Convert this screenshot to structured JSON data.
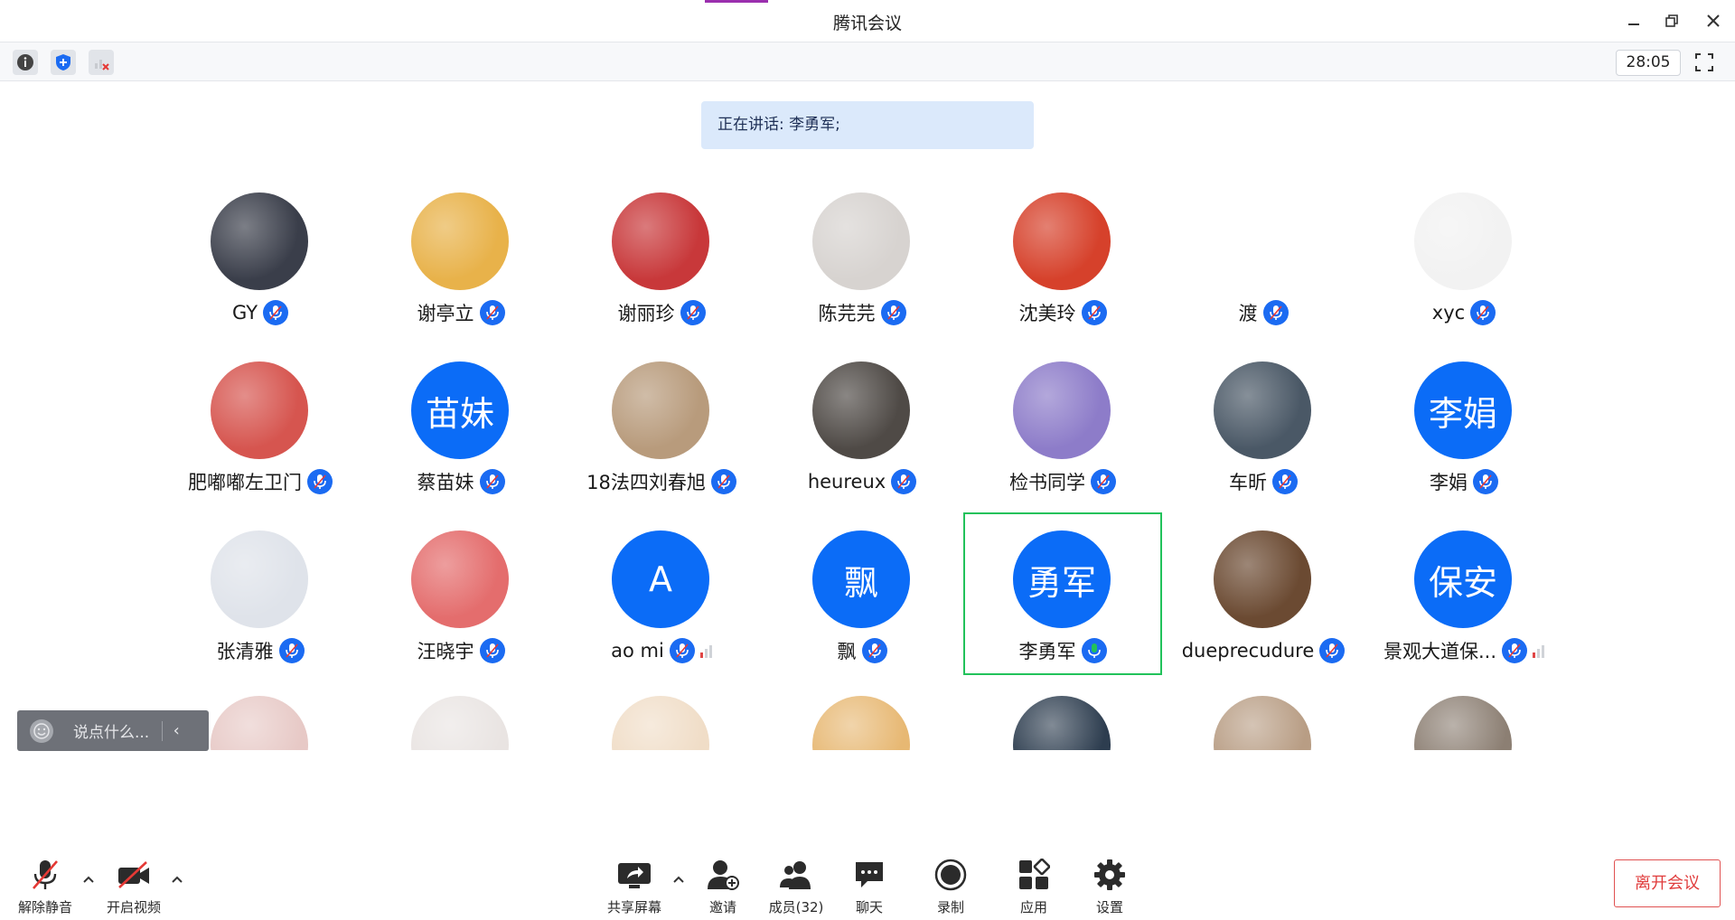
{
  "app": {
    "title": "腾讯会议",
    "timer": "28:05"
  },
  "speaking": {
    "text": "正在讲话: 李勇军;"
  },
  "participants": [
    {
      "name": "GY",
      "avatar": "photo",
      "color": "#3a3e4a"
    },
    {
      "name": "谢亭立",
      "avatar": "photo",
      "color": "#e8b24a"
    },
    {
      "name": "谢丽珍",
      "avatar": "photo",
      "color": "#c8383a"
    },
    {
      "name": "陈芫芫",
      "avatar": "photo",
      "color": "#d7d3d0"
    },
    {
      "name": "沈美玲",
      "avatar": "photo",
      "color": "#d6412b"
    },
    {
      "name": "渡",
      "avatar": "photo",
      "color": "#ffffff"
    },
    {
      "name": "xyc",
      "avatar": "photo",
      "color": "#f2f2f2"
    },
    {
      "name": "肥嘟嘟左卫门",
      "avatar": "photo",
      "color": "#d6554f"
    },
    {
      "name": "蔡苗妹",
      "avatar": "initials",
      "initials": "苗妹"
    },
    {
      "name": "18法四刘春旭",
      "avatar": "photo",
      "color": "#b89b7c"
    },
    {
      "name": "heureux",
      "avatar": "photo",
      "color": "#4f4a46"
    },
    {
      "name": "检书同学",
      "avatar": "photo",
      "color": "#8d7cc9"
    },
    {
      "name": "车昕",
      "avatar": "photo",
      "color": "#4a5866"
    },
    {
      "name": "李娟",
      "avatar": "initials",
      "initials": "李娟"
    },
    {
      "name": "张清雅",
      "avatar": "photo",
      "color": "#dfe3ea"
    },
    {
      "name": "汪晓宇",
      "avatar": "photo",
      "color": "#e46d6d"
    },
    {
      "name": "ao mi",
      "avatar": "initials",
      "initials": "A",
      "signal": true
    },
    {
      "name": "飘",
      "avatar": "initials",
      "initials": "飘"
    },
    {
      "name": "李勇军",
      "avatar": "initials",
      "initials": "勇军",
      "speaking": true
    },
    {
      "name": "dueprecudure",
      "avatar": "photo",
      "color": "#6b4a32"
    },
    {
      "name": "景观大道保...",
      "avatar": "initials",
      "initials": "保安",
      "signal": true
    }
  ],
  "partial_row_colors": [
    "#e7c9c6",
    "#e9e4e2",
    "#f0ddc7",
    "#e7b873",
    "#2d3d4f",
    "#b89d84",
    "#8c7f73"
  ],
  "chat": {
    "placeholder": "说点什么..."
  },
  "toolbar": {
    "unmute": "解除静音",
    "start_video": "开启视频",
    "share_screen": "共享屏幕",
    "invite": "邀请",
    "members": "成员(32)",
    "chat": "聊天",
    "record": "录制",
    "apps": "应用",
    "settings": "设置",
    "leave": "离开会议"
  },
  "colors": {
    "accent_blue": "#0b6cf7",
    "speaking_green": "#22c25b",
    "leave_red": "#e03c3c"
  }
}
